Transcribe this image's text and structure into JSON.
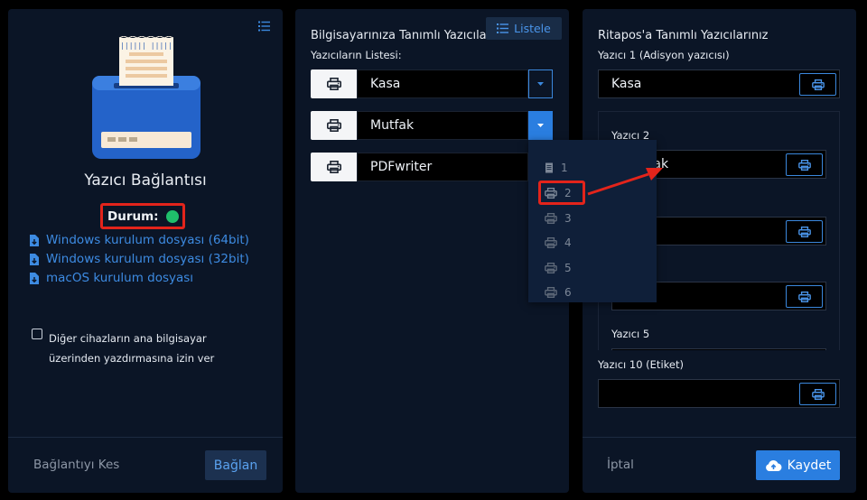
{
  "left": {
    "title": "Yazıcı Bağlantısı",
    "status_label": "Durum:",
    "status_color": "#1fbf6b",
    "links": [
      "Windows kurulum dosyası (64bit)",
      "Windows kurulum dosyası (32bit)",
      "macOS kurulum dosyası"
    ],
    "checkbox_line1": "Diğer cihazların ana bilgisayar",
    "checkbox_line2": "üzerinden yazdırmasına izin ver",
    "disconnect": "Bağlantıyı Kes",
    "connect": "Bağlan",
    "receipt_code": "|||||| |||||",
    "list_icon": "list-icon"
  },
  "middle": {
    "title": "Bilgisayarınıza Tanımlı Yazıcılar",
    "list_button": "Listele",
    "subtitle": "Yazıcıların Listesi:",
    "printers": [
      "Kasa",
      "Mutfak",
      "PDFwriter"
    ],
    "dropdown": [
      "1",
      "2",
      "3",
      "4",
      "5",
      "6"
    ]
  },
  "right": {
    "title": "Ritapos'a Tanımlı Yazıcılarınız",
    "p1_label": "Yazıcı 1 (Adisyon yazıcısı)",
    "p1_value": "Kasa",
    "p2_label": "Yazıcı 2",
    "p2_value": "Mutfak",
    "p5_label": "Yazıcı 5",
    "p10_label": "Yazıcı 10 (Etiket)",
    "p10_value": "",
    "cancel": "İptal",
    "save": "Kaydet"
  },
  "colors": {
    "accent": "#2a7ee0",
    "panel": "#0b1526",
    "highlight": "#e3241b"
  }
}
